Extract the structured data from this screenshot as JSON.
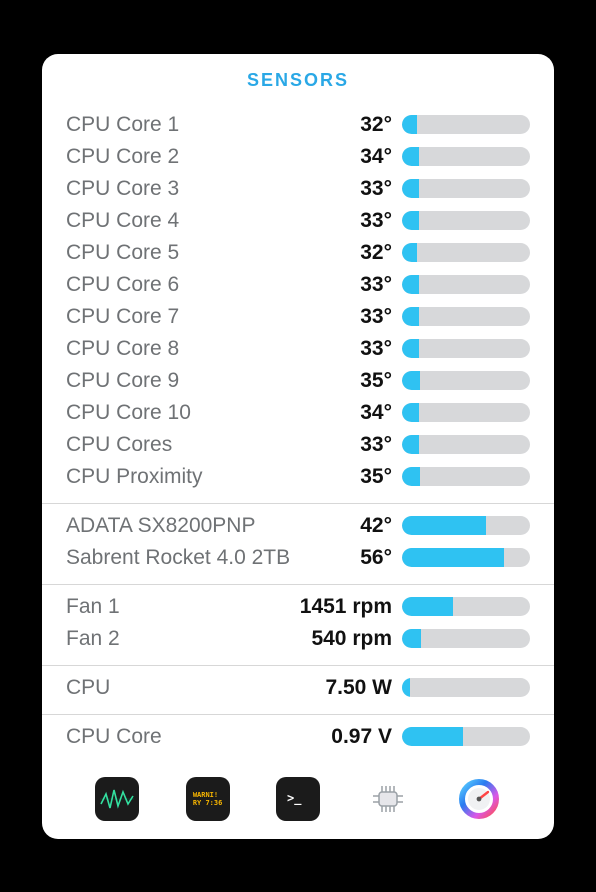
{
  "title": "SENSORS",
  "accent": "#2fc2f2",
  "sections": [
    {
      "rows": [
        {
          "label": "CPU Core 1",
          "value": "32°",
          "pct": 12
        },
        {
          "label": "CPU Core 2",
          "value": "34°",
          "pct": 13
        },
        {
          "label": "CPU Core 3",
          "value": "33°",
          "pct": 13
        },
        {
          "label": "CPU Core 4",
          "value": "33°",
          "pct": 13
        },
        {
          "label": "CPU Core 5",
          "value": "32°",
          "pct": 12
        },
        {
          "label": "CPU Core 6",
          "value": "33°",
          "pct": 13
        },
        {
          "label": "CPU Core 7",
          "value": "33°",
          "pct": 13
        },
        {
          "label": "CPU Core 8",
          "value": "33°",
          "pct": 13
        },
        {
          "label": "CPU Core 9",
          "value": "35°",
          "pct": 14
        },
        {
          "label": "CPU Core 10",
          "value": "34°",
          "pct": 13
        },
        {
          "label": "CPU Cores",
          "value": "33°",
          "pct": 13
        },
        {
          "label": "CPU Proximity",
          "value": "35°",
          "pct": 14
        }
      ]
    },
    {
      "rows": [
        {
          "label": "ADATA SX8200PNP",
          "value": "42°",
          "pct": 66
        },
        {
          "label": "Sabrent Rocket 4.0 2TB",
          "value": "56°",
          "pct": 80
        }
      ]
    },
    {
      "rows": [
        {
          "label": "Fan 1",
          "value": "1451 rpm",
          "pct": 40
        },
        {
          "label": "Fan 2",
          "value": "540 rpm",
          "pct": 15
        }
      ]
    },
    {
      "rows": [
        {
          "label": "CPU",
          "value": "7.50 W",
          "pct": 6
        }
      ]
    },
    {
      "rows": [
        {
          "label": "CPU Core",
          "value": "0.97 V",
          "pct": 48
        }
      ]
    }
  ],
  "dock": [
    {
      "name": "activity-monitor-icon"
    },
    {
      "name": "console-icon"
    },
    {
      "name": "terminal-icon"
    },
    {
      "name": "system-info-icon"
    },
    {
      "name": "speedometer-icon"
    }
  ]
}
